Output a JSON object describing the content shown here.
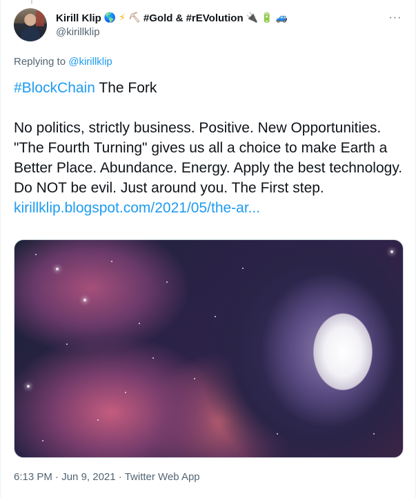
{
  "author": {
    "display_name": "Kirill Klip",
    "handle": "@kirillklip",
    "name_suffix_text": "#Gold & #rEVolution",
    "icons": [
      "globe-icon",
      "bolt-icon",
      "pick-icon",
      "plug-icon",
      "battery-icon",
      "car-icon"
    ]
  },
  "reply": {
    "prefix": "Replying to",
    "target": "@kirillklip"
  },
  "tweet": {
    "hashtag": "#BlockChain",
    "title_rest": " The Fork",
    "body": "No politics, strictly business. Positive. New Opportunities. \"The Fourth Turning\" gives us all a choice to make Earth a Better Place. Abundance. Energy. Apply the best technology. Do NOT be evil. Just around you. The First step.",
    "link": "kirillklip.blogspot.com/2021/05/the-ar..."
  },
  "meta": {
    "time": "6:13 PM",
    "separator1": " · ",
    "date": "Jun 9, 2021",
    "separator2": " · ",
    "client": "Twitter Web App"
  },
  "more_label": "···",
  "colors": {
    "accent": "#1d9bf0",
    "text": "#0f1419",
    "muted": "#536471"
  }
}
